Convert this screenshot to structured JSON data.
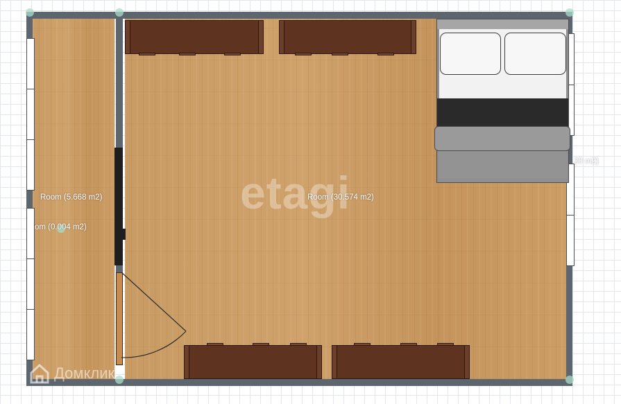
{
  "rooms": [
    {
      "label": "Room (5.668 m2)"
    },
    {
      "label": "Room (30.574 m2)"
    },
    {
      "label": "om (0.004 m2)"
    },
    {
      "label": "20 m2)"
    }
  ],
  "watermark": "etagi",
  "logo": {
    "text": "Домклик",
    "icon": "house-icon"
  },
  "colors": {
    "wall": "#5d666f",
    "floor": "#c89a63",
    "furniture": "#5e3421",
    "bedding": "#f2f2f2",
    "blanket": "#2a2a2a",
    "bed_frame": "#8f8f8f",
    "door": "#c98c4e"
  }
}
